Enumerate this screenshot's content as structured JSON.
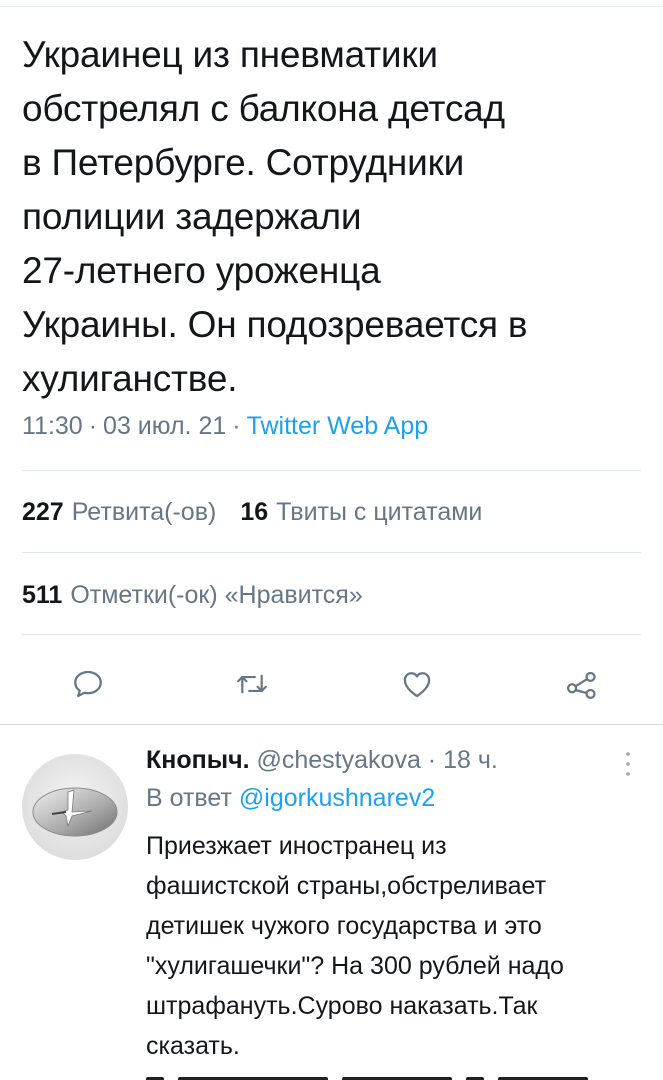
{
  "tweet": {
    "text": "Украинец из пневматики\nобстрелял с балкона детсад\nв Петербурге.  Сотрудники\nполиции задержали\n27-летнего уроженца\nУкраины. Он подозревается в\nхулиганстве.",
    "time": "11:30",
    "date": "03 июл. 21",
    "source": "Twitter Web App"
  },
  "stats": {
    "retweets_count": "227",
    "retweets_label": "Ретвита(-ов)",
    "quotes_count": "16",
    "quotes_label": "Твиты с цитатами",
    "likes_count": "511",
    "likes_label": "Отметки(-ок) «Нравится»"
  },
  "actions": {
    "icons": [
      "reply-icon",
      "retweet-icon",
      "like-icon",
      "share-icon"
    ]
  },
  "reply": {
    "name": "Кнопыч.",
    "handle": "@chestyakova",
    "age": "18 ч.",
    "reply_to_label": "В ответ",
    "reply_to_handle": "@igorkushnarev2",
    "text": "Приезжает иностранец из\nфашистской страны,обстреливает\nдетишек чужого государства и это\n\"хулигашечки\"? На 300 рублей надо\nштрафануть.Сурово наказать.Так\nсказать."
  },
  "colors": {
    "text": "#14171a",
    "secondary": "#657786",
    "link": "#1da1f2",
    "divider": "#e1e8ed"
  }
}
